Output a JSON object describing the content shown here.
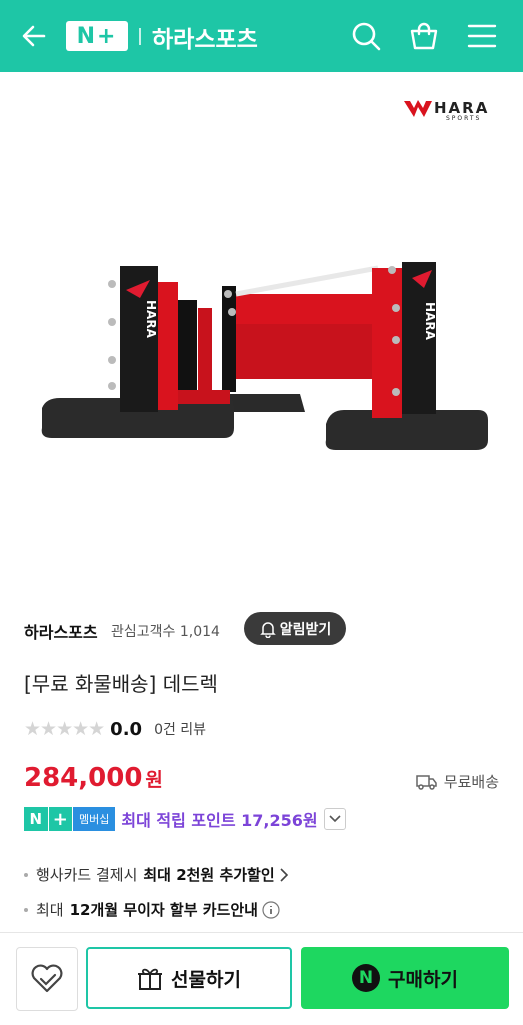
{
  "header": {
    "badge": "N+",
    "shop_title": "하라스포츠",
    "bg_color": "#1ec6a6"
  },
  "icons": {
    "back": "back-arrow-icon",
    "search": "search-icon",
    "cart": "shopping-bag-icon",
    "menu": "hamburger-menu-icon"
  },
  "brand": {
    "logo_text": "HARA",
    "logo_sub": "SPORTS",
    "product_logo_text": "HARA",
    "product_logo_sub": "SPORTS"
  },
  "store": {
    "name": "하라스포츠",
    "fav_label": "관심고객수 1,014",
    "alarm_label": "알림받기"
  },
  "product": {
    "title": "[무료 화물배송] 데드렉",
    "rating": "0.0",
    "review": "0건 리뷰",
    "price": "284,000",
    "price_unit": "원",
    "price_color": "#e01b30",
    "shipping": "무료배송"
  },
  "points": {
    "n": "N",
    "plus": "+",
    "member": "멤버십",
    "text": "최대 적립 포인트 17,256원"
  },
  "benefits": {
    "b1_prefix": "행사카드 결제시",
    "b1_strong": "최대 2천원 추가할인",
    "b2_prefix": "최대",
    "b2_strong": "12개월 무이자 할부 카드안내"
  },
  "bottom": {
    "gift_label": "선물하기",
    "buy_n": "N",
    "buy_label": "구매하기",
    "buy_color": "#1ed760"
  }
}
